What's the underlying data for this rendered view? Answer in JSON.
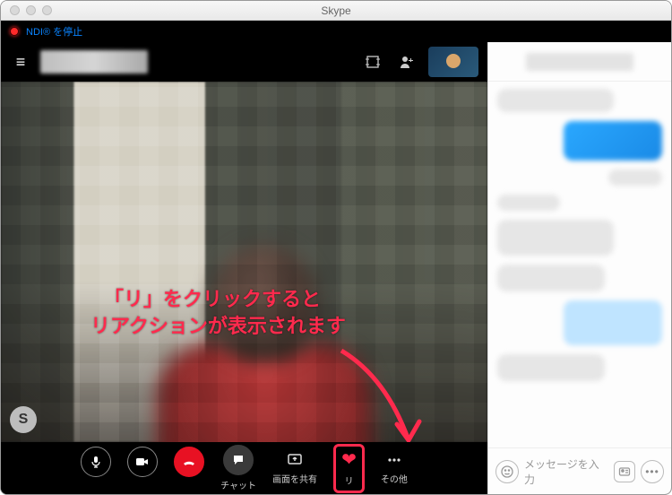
{
  "window": {
    "title": "Skype"
  },
  "toolbar": {
    "ndi_label": "NDI® を停止"
  },
  "callbar": {
    "chat": "チャット",
    "share": "画面を共有",
    "reaction": "リ",
    "more": "その他"
  },
  "annotation": {
    "line1": "「リ」をクリックすると",
    "line2": "リアクションが表示されます"
  },
  "avatar_initial": "S",
  "chat_input": {
    "placeholder": "メッセージを入力"
  }
}
